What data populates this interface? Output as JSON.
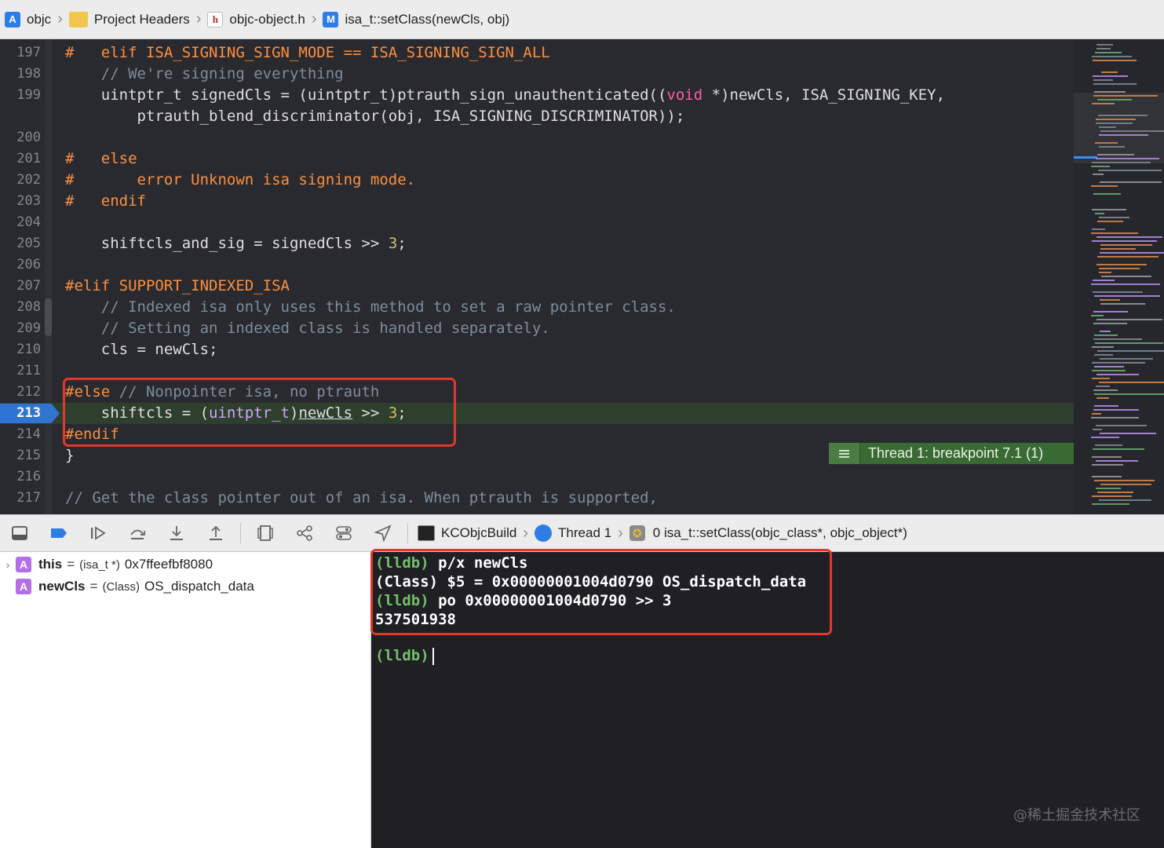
{
  "breadcrumb": {
    "items": [
      {
        "label": "objc",
        "icon": "xcode-project-icon"
      },
      {
        "label": "Project Headers",
        "icon": "folder-icon"
      },
      {
        "label": "objc-object.h",
        "icon": "header-file-icon"
      },
      {
        "label": "isa_t::setClass(newCls, obj)",
        "icon": "method-icon"
      }
    ]
  },
  "editor": {
    "lines": [
      {
        "n": "197",
        "segs": [
          [
            "pp",
            "#   elif ISA_SIGNING_SIGN_MODE == ISA_SIGNING_SIGN_ALL"
          ]
        ]
      },
      {
        "n": "198",
        "segs": [
          [
            "cm",
            "    // We're signing everything"
          ]
        ]
      },
      {
        "n": "199",
        "segs": [
          [
            "",
            "    uintptr_t signedCls = (uintptr_t)ptrauth_sign_unauthenticated(("
          ],
          [
            "kw",
            "void"
          ],
          [
            "",
            " *)newCls, ISA_SIGNING_KEY,"
          ]
        ]
      },
      {
        "n": "",
        "segs": [
          [
            "",
            "        ptrauth_blend_discriminator(obj, ISA_SIGNING_DISCRIMINATOR));"
          ]
        ]
      },
      {
        "n": "200",
        "segs": []
      },
      {
        "n": "201",
        "segs": [
          [
            "pp",
            "#   else"
          ]
        ]
      },
      {
        "n": "202",
        "segs": [
          [
            "pp",
            "#       error Unknown isa signing mode."
          ]
        ]
      },
      {
        "n": "203",
        "segs": [
          [
            "pp",
            "#   endif"
          ]
        ]
      },
      {
        "n": "204",
        "segs": []
      },
      {
        "n": "205",
        "segs": [
          [
            "",
            "    shiftcls_and_sig = signedCls >> "
          ],
          [
            "num",
            "3"
          ],
          [
            "",
            ";"
          ]
        ]
      },
      {
        "n": "206",
        "segs": []
      },
      {
        "n": "207",
        "segs": [
          [
            "pp",
            "#elif SUPPORT_INDEXED_ISA"
          ]
        ]
      },
      {
        "n": "208",
        "segs": [
          [
            "cm",
            "    // Indexed isa only uses this method to set a raw pointer class."
          ]
        ]
      },
      {
        "n": "209",
        "segs": [
          [
            "cm",
            "    // Setting an indexed class is handled separately."
          ]
        ]
      },
      {
        "n": "210",
        "segs": [
          [
            "",
            "    cls = newCls;"
          ]
        ]
      },
      {
        "n": "211",
        "segs": []
      },
      {
        "n": "212",
        "segs": [
          [
            "pp",
            "#else "
          ],
          [
            "cm",
            "// Nonpointer isa, no ptrauth"
          ]
        ]
      },
      {
        "n": "213",
        "current": true,
        "segs": [
          [
            "",
            "    shiftcls = ("
          ],
          [
            "ty",
            "uintptr_t"
          ],
          [
            "",
            ")"
          ],
          [
            "ul",
            "newCls"
          ],
          [
            "",
            " >> "
          ],
          [
            "num",
            "3"
          ],
          [
            "",
            ";"
          ]
        ]
      },
      {
        "n": "214",
        "segs": [
          [
            "pp",
            "#endif"
          ]
        ]
      },
      {
        "n": "215",
        "segs": [
          [
            "",
            "}"
          ]
        ]
      },
      {
        "n": "216",
        "segs": []
      },
      {
        "n": "217",
        "segs": [
          [
            "cm",
            "// Get the class pointer out of an isa. When ptrauth is supported,"
          ]
        ]
      }
    ],
    "breakpoint_badge": "Thread 1: breakpoint 7.1 (1)"
  },
  "debug_toolbar": {
    "scheme": "KCObjcBuild",
    "thread": "Thread 1",
    "frame": "0 isa_t::setClass(objc_class*, objc_object*)"
  },
  "variables": [
    {
      "name": "this",
      "type": "(isa_t *)",
      "value": "0x7ffeefbf8080",
      "expandable": true
    },
    {
      "name": "newCls",
      "type": "(Class)",
      "value": "OS_dispatch_data",
      "expandable": false
    }
  ],
  "console": {
    "lines": [
      {
        "prompt": "(lldb)",
        "text": " p/x newCls"
      },
      {
        "prompt": "",
        "text": "(Class) $5 = 0x00000001004d0790 OS_dispatch_data"
      },
      {
        "prompt": "(lldb)",
        "text": " po 0x00000001004d0790 >> 3"
      },
      {
        "prompt": "",
        "text": "537501938"
      }
    ],
    "active_prompt": "(lldb)",
    "watermark": "@稀土掘金技术社区"
  },
  "colors": {
    "preprocessor": "#fd8f3f",
    "comment": "#7f8c98",
    "keyword": "#fc5fa3",
    "type": "#d0a8ff",
    "number": "#d0bf69",
    "highlight_box": "#e0392b",
    "lldb_prompt": "#73c06a"
  }
}
